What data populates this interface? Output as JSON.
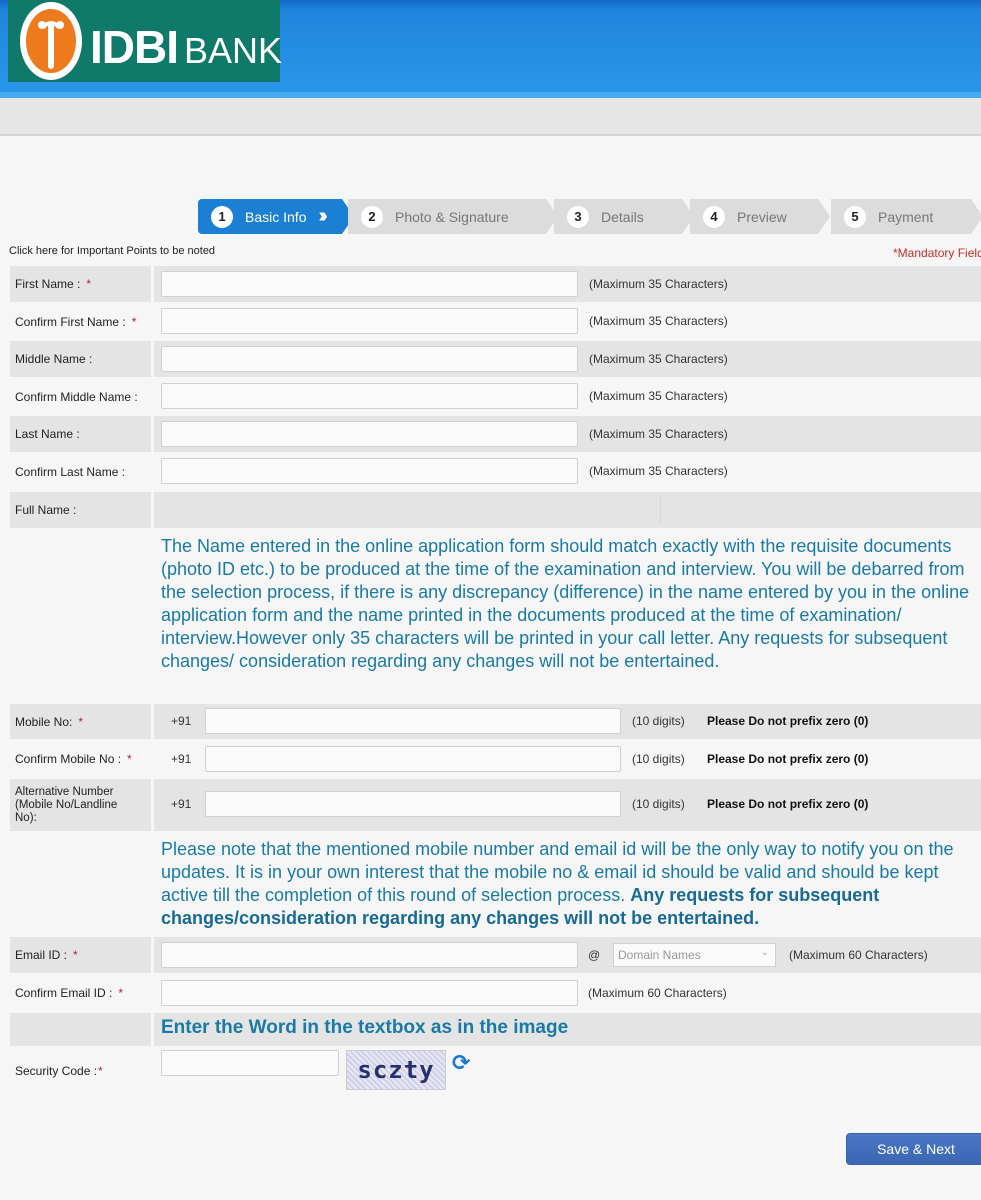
{
  "header": {
    "brand_primary": "IDBI",
    "brand_secondary": "BANK",
    "colors": {
      "header_blue": "#2590e4",
      "logo_green": "#0f7a6a",
      "logo_orange": "#ee7a1e"
    }
  },
  "steps": [
    {
      "num": "1",
      "label": "Basic Info",
      "active": true
    },
    {
      "num": "2",
      "label": "Photo & Signature",
      "active": false
    },
    {
      "num": "3",
      "label": "Details",
      "active": false
    },
    {
      "num": "4",
      "label": "Preview",
      "active": false
    },
    {
      "num": "5",
      "label": "Payment",
      "active": false
    }
  ],
  "important_link": "Click here for Important Points to be noted",
  "mandatory_note": "*Mandatory Fields",
  "name_fields": [
    {
      "label": "First Name :",
      "required": true,
      "value": "",
      "hint": "(Maximum 35 Characters)"
    },
    {
      "label": "Confirm First Name :",
      "required": true,
      "value": "",
      "hint": "(Maximum 35 Characters)"
    },
    {
      "label": "Middle Name :",
      "required": false,
      "value": "",
      "hint": "(Maximum 35 Characters)"
    },
    {
      "label": "Confirm Middle Name :",
      "required": false,
      "value": "",
      "hint": "(Maximum 35 Characters)"
    },
    {
      "label": "Last Name :",
      "required": false,
      "value": "",
      "hint": "(Maximum 35 Characters)"
    },
    {
      "label": "Confirm Last Name :",
      "required": false,
      "value": "",
      "hint": "(Maximum 35 Characters)"
    }
  ],
  "full_name": {
    "label": "Full Name :",
    "value": ""
  },
  "name_notice": "The Name entered in the online application form should match exactly with the requisite documents (photo ID etc.) to be produced at the time of the examination and interview. You will be debarred from the selection process, if there is any discrepancy (difference) in the name entered by you in the online application form and the name printed in the documents produced at the time of examination/ interview.However only 35 characters will be printed in your call letter. Any requests for subsequent changes/ consideration regarding any changes will not be entertained.",
  "phone_fields": [
    {
      "label": "Mobile No:",
      "required": true,
      "prefix": "+91",
      "value": "",
      "hint": "(10 digits)",
      "note": "Please Do not prefix zero (0)"
    },
    {
      "label": "Confirm Mobile No :",
      "required": true,
      "prefix": "+91",
      "value": "",
      "hint": "(10 digits)",
      "note": "Please Do not prefix zero (0)"
    },
    {
      "label": "Alternative Number (Mobile No/Landline No):",
      "required": false,
      "prefix": "+91",
      "value": "",
      "hint": "(10 digits)",
      "note": "Please Do not prefix zero (0)"
    }
  ],
  "contact_notice": {
    "text": "Please note that the mentioned mobile number and email id will be the only way to notify you on the updates. It is in your own interest that the mobile no & email id should be valid and should be kept active till the completion of this round of selection process. ",
    "bold": "Any requests for subsequent changes/consideration regarding any changes will not be entertained."
  },
  "email": {
    "label": "Email ID :",
    "required": true,
    "value": "",
    "at": "@",
    "domain_placeholder": "Domain Names",
    "hint": "(Maximum 60 Characters)"
  },
  "confirm_email": {
    "label": "Confirm Email ID :",
    "required": true,
    "value": "",
    "hint": "(Maximum 60 Characters)"
  },
  "captcha": {
    "title": "Enter the Word in the textbox as in the image",
    "label": "Security Code :",
    "required": true,
    "value": "",
    "image_text": "sczty",
    "refresh_icon": "refresh-icon"
  },
  "actions": {
    "save_next": "Save & Next"
  }
}
